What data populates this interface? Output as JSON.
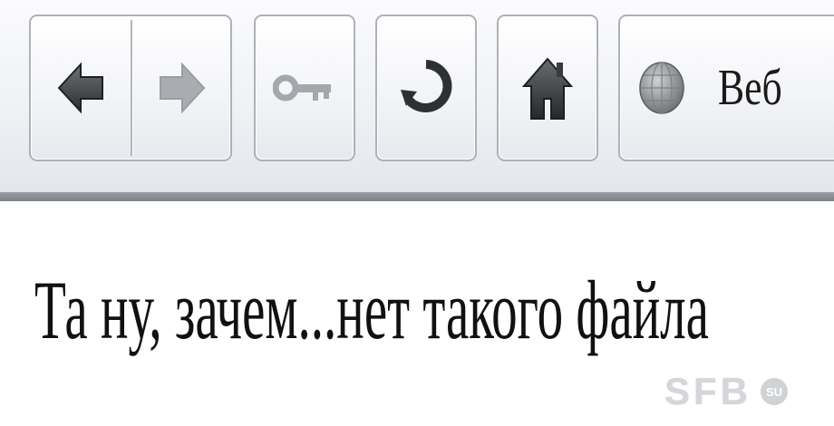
{
  "toolbar": {
    "buttons": [
      {
        "name": "back",
        "icon": "back-arrow-icon"
      },
      {
        "name": "forward",
        "icon": "forward-arrow-icon"
      },
      {
        "name": "key",
        "icon": "key-icon"
      },
      {
        "name": "refresh",
        "icon": "refresh-icon"
      },
      {
        "name": "home",
        "icon": "home-icon"
      }
    ],
    "address": {
      "icon": "globe-icon",
      "text": "Веб"
    }
  },
  "content": {
    "message": "Та ну, зачем...нет такого файла"
  },
  "watermark": {
    "text": "SFB",
    "badge": "SU"
  },
  "colors": {
    "toolbar_bg": "#eef0f4",
    "button_border": "#aeb1b7",
    "icon_dark": "#3a3a3a",
    "icon_disabled": "#a4a7ac"
  }
}
